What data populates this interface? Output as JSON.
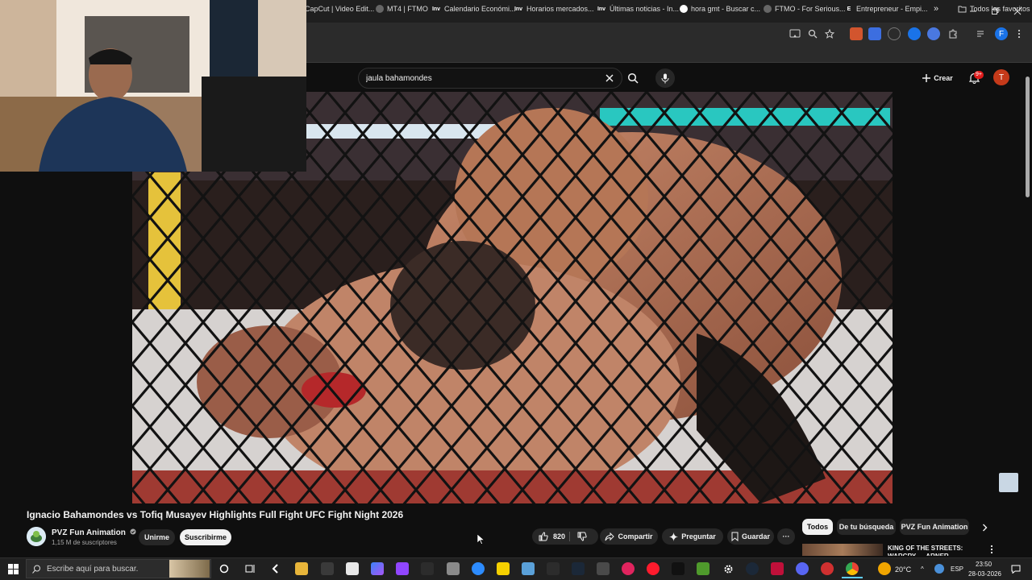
{
  "browser": {
    "bookmarks": [
      {
        "label": "CapCut | Video Edit...",
        "icon": "capcut-icon",
        "color": "#2b2b2b"
      },
      {
        "label": "MT4 | FTMO",
        "icon": "globe-icon",
        "color": "#555555"
      },
      {
        "label": "Calendario Económi...",
        "icon": "investing-icon",
        "color": "#333333"
      },
      {
        "label": "Horarios mercados...",
        "icon": "investing-icon",
        "color": "#333333"
      },
      {
        "label": "Últimas noticias - In...",
        "icon": "investing-icon",
        "color": "#333333"
      },
      {
        "label": "hora gmt - Buscar c...",
        "icon": "google-icon",
        "color": "#4285f4"
      },
      {
        "label": "FTMO - For Serious...",
        "icon": "globe-icon",
        "color": "#555555"
      },
      {
        "label": "Entrepreneur - Empi...",
        "icon": "entrepreneur-icon",
        "color": "#333333"
      }
    ],
    "bookmarks_more": "»",
    "all_bookmarks": "Todos los favoritos",
    "profile_initial": "F",
    "bookmark_fav_letters": {
      "investing": "Inv",
      "entrepreneur": "E"
    }
  },
  "youtube": {
    "search": {
      "value": "jaula bahamondes",
      "clear": "✕"
    },
    "create_label": "Crear",
    "notifications_badge": "9+",
    "account_initial": "T",
    "video": {
      "title": "Ignacio Bahamondes vs Tofiq Musayev Highlights Full Fight UFC Fight Night 2026",
      "channel": "PVZ Fun Animation",
      "subscribers": "1,15 M de suscriptores",
      "join_label": "Unirme",
      "subscribe_label": "Suscribirme",
      "likes": "820",
      "share_label": "Compartir",
      "ask_label": "Preguntar",
      "save_label": "Guardar",
      "more_label": "···"
    },
    "chips": [
      "Todos",
      "De tu búsqueda",
      "PVZ Fun Animation"
    ],
    "recommendation": {
      "title": "KING OF THE STREETS: WARCRY — ARNER LLOVERAS"
    }
  },
  "taskbar": {
    "search_placeholder": "Escribe aquí para buscar.",
    "weather": "20°C",
    "language": "ESP",
    "time": "23:50",
    "date": "28-03-2026"
  },
  "colors": {
    "youtube_red": "#ff0000",
    "notification_red": "#e01b1b",
    "account_avatar": "#c53a1a",
    "profile_avatar": "#1a73e8"
  }
}
